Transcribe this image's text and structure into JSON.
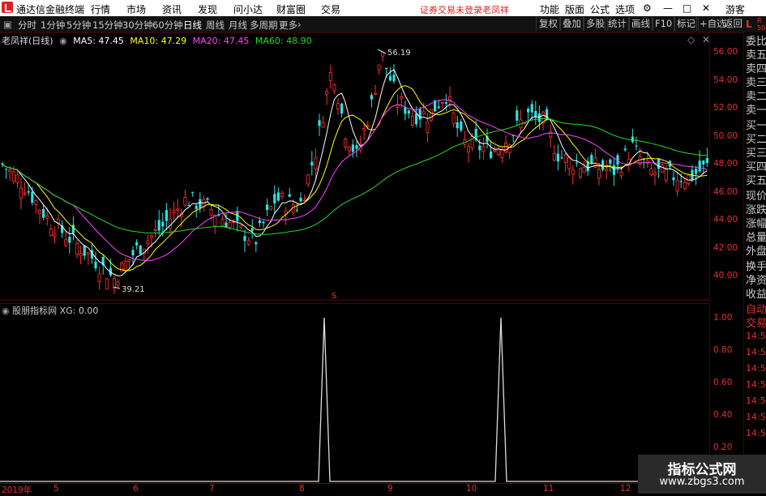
{
  "titlebar": {
    "app_name": "通达信金融终端",
    "menus": [
      "行情",
      "市场",
      "资讯",
      "发现",
      "问小达",
      "财富圈",
      "交易"
    ],
    "notice": "证券交易未登录",
    "user_name": "老凤祥",
    "right_menus": [
      "功能",
      "版面",
      "公式",
      "选项"
    ],
    "guest": "游客"
  },
  "toolbar": {
    "periods": [
      "分时",
      "1分钟",
      "5分钟",
      "15分钟",
      "30分钟",
      "60分钟",
      "日线",
      "周线",
      "月线",
      "多周期",
      "更多"
    ],
    "active_period": "日线",
    "right_buttons": [
      "复权",
      "叠加",
      "多股",
      "统计",
      "画线",
      "F10",
      "标记",
      "+自选",
      "返回"
    ]
  },
  "main_chart": {
    "stock_label": "老凤祥(日线)",
    "ma": [
      {
        "label": "MA5: 47.45",
        "color": "#ffffff"
      },
      {
        "label": "MA10: 47.29",
        "color": "#ffff00"
      },
      {
        "label": "MA20: 47.45",
        "color": "#ff44ff"
      },
      {
        "label": "MA60: 48.90",
        "color": "#22dd22"
      }
    ],
    "high_label": "56.19",
    "low_label": "39.21",
    "marker": "S",
    "y_ticks": [
      "56.00",
      "54.00",
      "52.00",
      "50.00",
      "48.00",
      "46.00",
      "44.00",
      "42.00",
      "40.00"
    ]
  },
  "sub_chart": {
    "label": "股朋指标网 XG: 0.00",
    "y_ticks": [
      "1.00",
      "0.80",
      "0.60",
      "0.40",
      "0.20"
    ]
  },
  "xaxis": {
    "labels": [
      "2019年",
      "5",
      "6",
      "7",
      "8",
      "9",
      "10",
      "11",
      "12"
    ]
  },
  "rightpanel": {
    "top_L": "L",
    "top_R": "R",
    "top_num": "500",
    "items": [
      "委比",
      "卖五",
      "卖四",
      "卖三",
      "卖二",
      "卖一",
      "买一",
      "买二",
      "买三",
      "买四",
      "买五",
      "现价",
      "涨跌",
      "涨幅",
      "总量",
      "外盘",
      "换手",
      "净资",
      "收益",
      "自动",
      "交易",
      "14:56",
      "14:56",
      "14:56",
      "14:56",
      "14:56",
      "14:56",
      "14:56"
    ]
  },
  "watermark": {
    "line1": "指标公式网",
    "line2": "www.zbgs3.com"
  },
  "colors": {
    "up": "#ff3030",
    "down": "#30e0e0",
    "axis": "#e03030"
  }
}
